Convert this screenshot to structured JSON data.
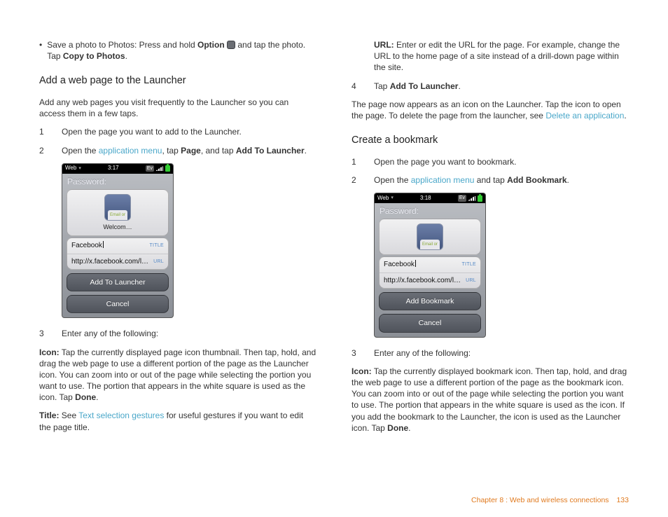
{
  "left": {
    "bullet_pre": "Save a photo to Photos: Press and hold ",
    "bullet_bold1": "Option",
    "bullet_mid": " and tap the photo. Tap ",
    "bullet_bold2": "Copy to Photos",
    "bullet_post": ".",
    "h_launcher": "Add a web page to the Launcher",
    "intro": "Add any web pages you visit frequently to the Launcher so you can access them in a few taps.",
    "s1": "Open the page you want to add to the Launcher.",
    "s2_pre": "Open the ",
    "s2_link": "application menu",
    "s2_mid": ", tap ",
    "s2_b1": "Page",
    "s2_mid2": ", and tap ",
    "s2_b2": "Add To Launcher",
    "s2_post": ".",
    "s3": "Enter any of the following:",
    "icon_b": "Icon:",
    "icon_t_pre": " Tap the currently displayed page icon thumbnail. Then tap, hold, and drag the web page to use a different portion of the page as the Launcher icon. You can zoom into or out of the page while selecting the portion you want to use. The portion that appears in the white square is used as the icon. Tap ",
    "icon_done": "Done",
    "icon_post": ".",
    "title_b": "Title:",
    "title_pre": " See ",
    "title_link": "Text selection gestures",
    "title_post": " for useful gestures if you want to edit the page title."
  },
  "right": {
    "url_b": "URL:",
    "url_t": " Enter or edit the URL for the page. For example, change the URL to the home page of a site instead of a drill-down page within the site.",
    "s4_pre": "Tap ",
    "s4_b": "Add To Launcher",
    "s4_post": ".",
    "after_pre": "The page now appears as an icon on the Launcher. Tap the icon to open the page. To delete the page from the launcher, see ",
    "after_link": "Delete an application",
    "after_post": ".",
    "h_bookmark": "Create a bookmark",
    "b1": "Open the page you want to bookmark.",
    "b2_pre": "Open the ",
    "b2_link": "application menu",
    "b2_mid": " and tap ",
    "b2_b": "Add Bookmark",
    "b2_post": ".",
    "b3": "Enter any of the following:",
    "icon_b": "Icon:",
    "icon_t_pre": " Tap the currently displayed bookmark icon. Then tap, hold, and drag the web page to use a different portion of the page as the bookmark icon. You can zoom into or out of the page while selecting the portion you want to use. The portion that appears in the white square is used as the icon. If you add the bookmark to the Launcher, the icon is used as the Launcher icon. Tap ",
    "icon_done": "Done",
    "icon_post": "."
  },
  "phoneA": {
    "web": "Web",
    "time": "3:17",
    "ev": "Ev",
    "pw": "Password:",
    "thumb_label": "Email or",
    "caption": "Welcom…",
    "title_val": "Facebook",
    "title_hint": "TITLE",
    "url_val": "http://x.facebook.com/l…",
    "url_hint": "URL",
    "btn1": "Add To Launcher",
    "btn2": "Cancel"
  },
  "phoneB": {
    "web": "Web",
    "time": "3:18",
    "ev": "Ev",
    "pw": "Password:",
    "thumb_label": "Email or",
    "title_val": "Facebook",
    "title_hint": "TITLE",
    "url_val": "http://x.facebook.com/l…",
    "url_hint": "URL",
    "btn1": "Add Bookmark",
    "btn2": "Cancel"
  },
  "footer": {
    "chapter": "Chapter 8 : Web and wireless connections",
    "page": "133"
  },
  "nums": {
    "n1": "1",
    "n2": "2",
    "n3": "3",
    "n4": "4"
  },
  "glyphs": {
    "bullet": "•"
  }
}
